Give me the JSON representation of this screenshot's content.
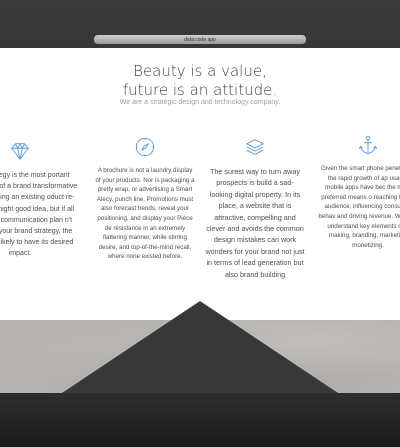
{
  "window": {
    "title": "data:code app"
  },
  "hero": {
    "headline_line1": "Beauty is a value,",
    "headline_line2": "future is an attitude.",
    "tagline": "We are a strategic design and technology company."
  },
  "features": [
    {
      "icon": "diamond-icon",
      "text": "and Strategy is the most portant component of a brand transformative ocess. Having an existing oduct re-designed might good idea, but if all ends your communication plan n't align with your brand strategy, the attempt is likely to have its desired impact."
    },
    {
      "icon": "compass-icon",
      "text": "A brochure is not a laundry display of your products. Nor is packaging a pretty wrap, or advertising a Smart Alecy, punch line. Promotions must also forecast trends, reveal your positioning, and display your Pièce de résistance in an extremely flattering manner, while stirring desire, and top-of-the-mind recall, where none existed before."
    },
    {
      "icon": "layers-icon",
      "text": "The surest way to turn away prospects is build a sad-looking digital property. In its place, a website that is attractive, compelling and clever and avoids the common design mistakes can work wonders for your brand not just in terms of lead generation but also brand building"
    },
    {
      "icon": "anchor-icon",
      "text": "Given the smart phone penetr and the rapid growth of ap usage, mobile apps have bec the most preferred means o reaching target audience, influencing consumer behav and driving revenue. We help understand key elements of a making, branding, marketing monetizing."
    }
  ],
  "colors": {
    "accent": "#5b9bd5",
    "text": "#4a4f56",
    "headline": "#3b4350"
  }
}
